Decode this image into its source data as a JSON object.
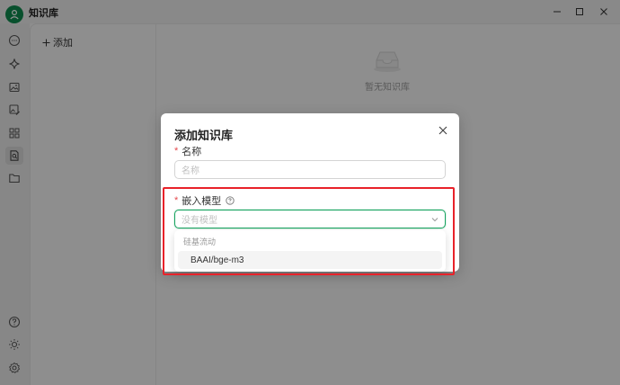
{
  "app": {
    "title": "知识库"
  },
  "sidebar": {
    "items": [
      {
        "name": "chat-icon"
      },
      {
        "name": "sparkle-icon"
      },
      {
        "name": "image-icon"
      },
      {
        "name": "image-edit-icon"
      },
      {
        "name": "grid-icon"
      },
      {
        "name": "knowledge-icon",
        "active": true
      },
      {
        "name": "folder-icon"
      }
    ],
    "bottom": [
      {
        "name": "help-icon"
      },
      {
        "name": "sun-icon"
      },
      {
        "name": "gear-icon"
      }
    ]
  },
  "panel": {
    "add_label": "添加",
    "empty_text": "暂无知识库"
  },
  "modal": {
    "title": "添加知识库",
    "name_label": "名称",
    "name_placeholder": "名称",
    "model_label": "嵌入模型",
    "model_placeholder": "没有模型",
    "dropdown": {
      "group": "硅基流动",
      "options": [
        "BAAI/bge-m3"
      ]
    }
  },
  "colors": {
    "brand": "#0e8a4e",
    "focus": "#16a35f",
    "required": "#e5484d",
    "highlight": "#e8222a"
  }
}
